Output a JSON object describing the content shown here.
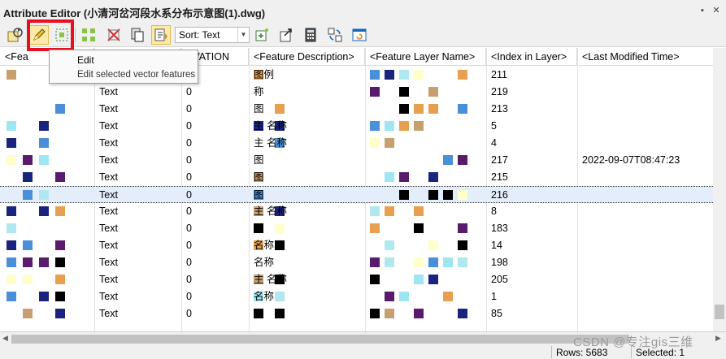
{
  "window": {
    "title": "Attribute Editor (小清河岔河段水系分布示意图(1).dwg)",
    "pin_glyph": "▪",
    "close_glyph": "✕"
  },
  "toolbar": {
    "sort_label": "Sort: Text",
    "arrow_glyph": "▼",
    "highlighted_button": "edit",
    "buttons": [
      {
        "name": "refresh-attributes-icon"
      },
      {
        "name": "edit-pencil-icon"
      },
      {
        "name": "select-features-icon"
      },
      {
        "name": "select-all-icon"
      },
      {
        "name": "delete-features-icon"
      },
      {
        "name": "copy-paste-icon"
      },
      {
        "name": "sort-icon"
      },
      {
        "name": "add-field-icon"
      },
      {
        "name": "export-icon"
      },
      {
        "name": "calculator-icon"
      },
      {
        "name": "sync-icon"
      },
      {
        "name": "refresh-table-icon"
      }
    ]
  },
  "tooltip": {
    "title": "Edit",
    "description": "Edit selected vector features"
  },
  "grid": {
    "columns": [
      "<Fea",
      "",
      "EVATION",
      "<Feature Description>",
      "<Feature Layer Name>",
      "<Index in Layer>",
      "<Last Modified Time>"
    ],
    "rows": [
      {
        "type": "",
        "elev": "",
        "desc": "图例",
        "index": "211",
        "time": ""
      },
      {
        "type": "Text",
        "elev": "0",
        "desc": "称",
        "index": "219",
        "time": ""
      },
      {
        "type": "Text",
        "elev": "0",
        "desc": "图",
        "index": "213",
        "time": ""
      },
      {
        "type": "Text",
        "elev": "0",
        "desc": "主 名称",
        "index": "5",
        "time": ""
      },
      {
        "type": "Text",
        "elev": "0",
        "desc": "主 名称",
        "index": "4",
        "time": ""
      },
      {
        "type": "Text",
        "elev": "0",
        "desc": "图",
        "index": "217",
        "time": "2022-09-07T08:47:23"
      },
      {
        "type": "Text",
        "elev": "0",
        "desc": "图",
        "index": "215",
        "time": ""
      },
      {
        "type": "Text",
        "elev": "0",
        "desc": "图",
        "index": "216",
        "time": ""
      },
      {
        "type": "Text",
        "elev": "0",
        "desc": "主 名称",
        "index": "8",
        "time": ""
      },
      {
        "type": "Text",
        "elev": "0",
        "desc": "",
        "index": "183",
        "time": ""
      },
      {
        "type": "Text",
        "elev": "0",
        "desc": "名称",
        "index": "14",
        "time": ""
      },
      {
        "type": "Text",
        "elev": "0",
        "desc": "名称",
        "index": "198",
        "time": ""
      },
      {
        "type": "Text",
        "elev": "0",
        "desc": "主 名称",
        "index": "205",
        "time": ""
      },
      {
        "type": "Text",
        "elev": "0",
        "desc": "名称",
        "index": "1",
        "time": ""
      },
      {
        "type": "Text",
        "elev": "0",
        "desc": "",
        "index": "85",
        "time": ""
      }
    ],
    "selected_row": 7
  },
  "status": {
    "rows_label": "Rows: 5683",
    "selected_label": "Selected: 1"
  },
  "watermark": "CSDN @专注gis三维",
  "colors": {
    "highlight_red": "#e8101f",
    "active_button": "#fde9a8",
    "mosaic": [
      "#e8a050",
      "#9ee6f2",
      "#000000",
      "#4a90d9",
      "#1a237e",
      "#ffffcc",
      "#5a1a6e",
      "#c8a070",
      "#b0e8f0"
    ]
  }
}
